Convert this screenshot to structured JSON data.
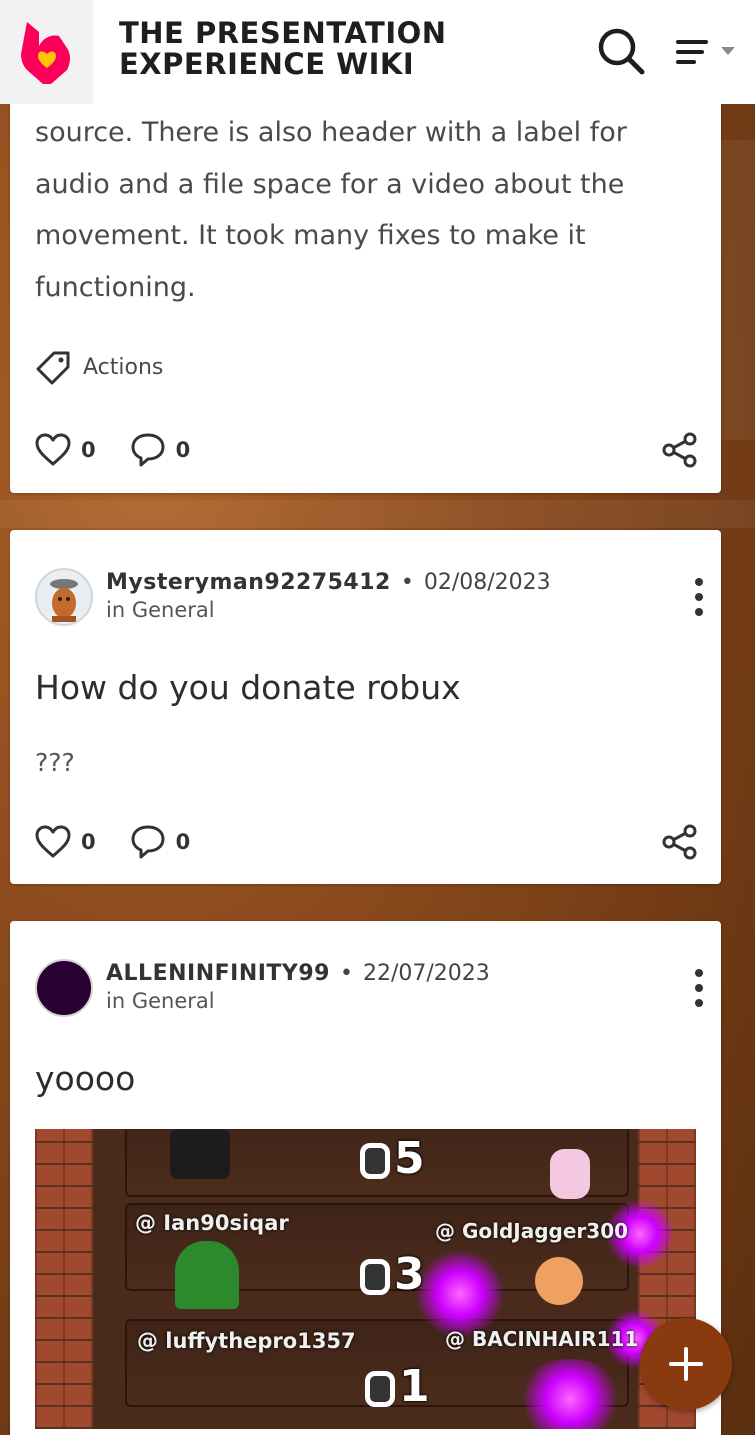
{
  "header": {
    "wiki_title_line1": "THE PRESENTATION",
    "wiki_title_line2": "EXPERIENCE WIKI",
    "icons": [
      "fandom-logo-icon",
      "search-icon",
      "menu-icon",
      "caret-down-icon"
    ]
  },
  "posts": [
    {
      "body_lines": [
        "source. There is also header with a label for",
        "audio and a file space for a video about the",
        "movement. It took many fixes to make it",
        "functioning."
      ],
      "tag": "Actions",
      "likes": "0",
      "comments": "0"
    },
    {
      "username": "Mysteryman92275412",
      "separator": "•",
      "date": "02/08/2023",
      "category": "in General",
      "title": "How do you donate robux",
      "body": "???",
      "likes": "0",
      "comments": "0"
    },
    {
      "username": "ALLENINFINITY99",
      "separator": "•",
      "date": "22/07/2023",
      "category": "in General",
      "title": "yoooo",
      "image": {
        "rank_top": "5",
        "rank_mid": "3",
        "rank_bottom": "1",
        "player_left_mid": "@ Ian90siqar",
        "player_right_mid": "@ GoldJagger300",
        "player_left_bottom": "@ luffythepro1357",
        "player_right_bottom": "@ BACINHAIR111"
      }
    }
  ],
  "fab": {
    "label": "+"
  },
  "colors": {
    "fandom_pink": "#fa005a",
    "fandom_yellow": "#ffc500",
    "fab_bg": "#8a3a0f",
    "background": "#8a4a1c"
  }
}
